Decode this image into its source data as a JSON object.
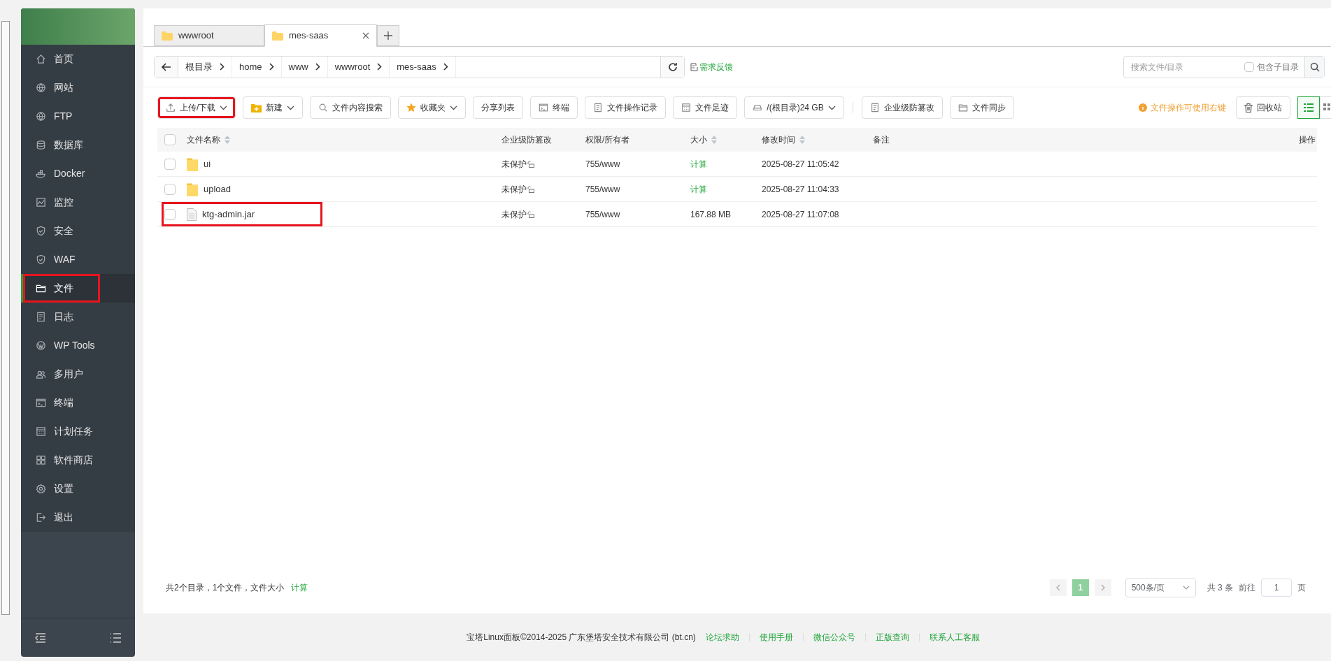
{
  "sidebar": {
    "items": [
      {
        "label": "首页",
        "selected": false
      },
      {
        "label": "网站",
        "selected": false
      },
      {
        "label": "FTP",
        "selected": false
      },
      {
        "label": "数据库",
        "selected": false
      },
      {
        "label": "Docker",
        "selected": false
      },
      {
        "label": "监控",
        "selected": false
      },
      {
        "label": "安全",
        "selected": false
      },
      {
        "label": "WAF",
        "selected": false
      },
      {
        "label": "文件",
        "selected": true
      },
      {
        "label": "日志",
        "selected": false
      },
      {
        "label": "WP Tools",
        "selected": false
      },
      {
        "label": "多用户",
        "selected": false
      },
      {
        "label": "终端",
        "selected": false
      },
      {
        "label": "计划任务",
        "selected": false
      },
      {
        "label": "软件商店",
        "selected": false
      },
      {
        "label": "设置",
        "selected": false
      },
      {
        "label": "退出",
        "selected": false
      }
    ]
  },
  "tabs": [
    {
      "label": "wwwroot",
      "selected": false
    },
    {
      "label": "mes-saas",
      "selected": true
    }
  ],
  "breadcrumb": {
    "segments": [
      "根目录",
      "home",
      "www",
      "wwwroot",
      "mes-saas"
    ]
  },
  "feedback_link": "需求反馈",
  "search": {
    "placeholder": "搜索文件/目录",
    "include_subdirs": {
      "label": "包含子目录",
      "checked": false
    }
  },
  "toolbar": {
    "buttons": [
      {
        "label": "上传/下载",
        "dropdown": true,
        "highlighted": true
      },
      {
        "label": "新建",
        "dropdown": true,
        "highlighted": false
      },
      {
        "label": "文件内容搜索",
        "dropdown": false,
        "highlighted": false
      },
      {
        "label": "收藏夹",
        "dropdown": true,
        "highlighted": false
      },
      {
        "label": "分享列表",
        "dropdown": false,
        "highlighted": false
      },
      {
        "label": "终端",
        "dropdown": false,
        "highlighted": false
      },
      {
        "label": "文件操作记录",
        "dropdown": false,
        "highlighted": false
      },
      {
        "label": "文件足迹",
        "dropdown": false,
        "highlighted": false
      },
      {
        "label": "/(根目录)24 GB",
        "dropdown": true,
        "highlighted": false
      },
      {
        "label": "企业级防篡改",
        "dropdown": false,
        "highlighted": false
      },
      {
        "label": "文件同步",
        "dropdown": false,
        "highlighted": false
      }
    ],
    "hint": "文件操作可使用右键",
    "recycle_button": "回收站",
    "view_modes": [
      {
        "kind": "list",
        "selected": true
      },
      {
        "kind": "grid",
        "selected": false
      }
    ]
  },
  "table": {
    "select_all_checked": false,
    "columns": [
      {
        "label": "文件名称",
        "sortable": true
      },
      {
        "label": "企业级防篡改",
        "sortable": false
      },
      {
        "label": "权限/所有者",
        "sortable": false
      },
      {
        "label": "大小",
        "sortable": true
      },
      {
        "label": "修改时间",
        "sortable": true
      },
      {
        "label": "备注",
        "sortable": false
      },
      {
        "label": "操作",
        "sortable": false
      }
    ],
    "rows": [
      {
        "name": "ui",
        "kind": "folder",
        "checked": false,
        "protection": "未保护",
        "permission": "755/www",
        "size": "计算",
        "size_link": true,
        "modified": "2025-08-27 11:05:42",
        "highlighted": false
      },
      {
        "name": "upload",
        "kind": "folder",
        "checked": false,
        "protection": "未保护",
        "permission": "755/www",
        "size": "计算",
        "size_link": true,
        "modified": "2025-08-27 11:04:33",
        "highlighted": false
      },
      {
        "name": "ktg-admin.jar",
        "kind": "file",
        "checked": false,
        "protection": "未保护",
        "permission": "755/www",
        "size": "167.88 MB",
        "size_link": false,
        "modified": "2025-08-27 11:07:08",
        "highlighted": true
      }
    ]
  },
  "summary": {
    "text": "共2个目录，1个文件，文件大小",
    "action": "计算"
  },
  "pagination": {
    "pages": [
      {
        "label": "1",
        "selected": true
      }
    ],
    "page_size": "500条/页",
    "total": "共 3 条",
    "goto_label": "前往",
    "goto_value": "1",
    "page_suffix": "页"
  },
  "footer": {
    "copyright": "宝塔Linux面板©2014-2025 广东堡塔安全技术有限公司 (bt.cn)",
    "links": [
      "论坛求助",
      "使用手册",
      "微信公众号",
      "正版查询",
      "联系人工客服"
    ]
  }
}
